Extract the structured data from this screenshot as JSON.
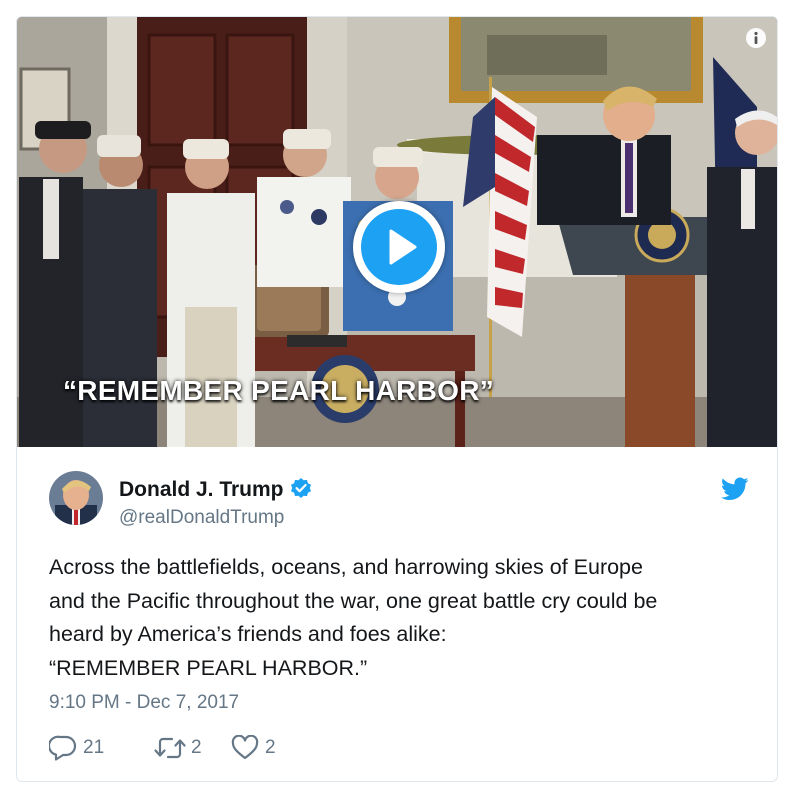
{
  "media": {
    "caption": "“REMEMBER PEARL HARBOR”",
    "play_icon": "play-icon",
    "info_icon": "info-icon"
  },
  "author": {
    "name": "Donald J. Trump",
    "handle": "@realDonaldTrump",
    "verified_icon": "verified-badge-icon",
    "platform_icon": "twitter-bird-icon"
  },
  "tweet": {
    "lines": [
      "Across the battlefields, oceans, and harrowing skies of Europe",
      "and the Pacific throughout the war, one great battle cry could be",
      "heard by America’s friends and foes alike:",
      "“REMEMBER PEARL HARBOR.”"
    ],
    "timestamp": "9:10 PM - Dec 7, 2017"
  },
  "actions": {
    "replies": "21",
    "retweets": "2",
    "likes": "2"
  },
  "colors": {
    "accent": "#1da1f2",
    "text": "#14171a",
    "muted": "#657786",
    "border": "#e1e8ed"
  }
}
